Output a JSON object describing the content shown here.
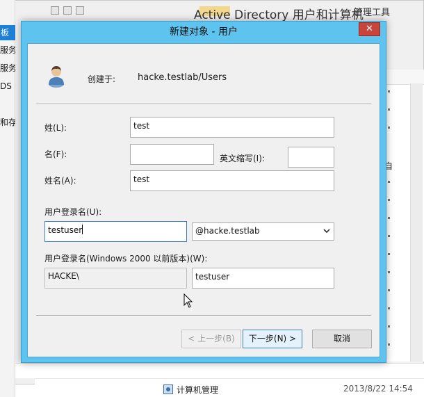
{
  "background": {
    "window_title": "Active Directory 用户和计算机",
    "menu_label": "管理工具",
    "left_items": [
      "板",
      "服务",
      "服务",
      "DS",
      "和存"
    ],
    "right_text": "自",
    "taskbar_item": "计算机管理",
    "timestamp": "2013/8/22 14:54"
  },
  "dialog": {
    "title": "新建对象 - 用户",
    "close_glyph": "✕",
    "created_in_label": "创建于:",
    "created_in_value": "hacke.testlab/Users",
    "last_name_label": "姓(L):",
    "last_name_value": "test",
    "first_name_label": "名(F):",
    "first_name_value": "",
    "initials_label": "英文缩写(I):",
    "initials_value": "",
    "full_name_label": "姓名(A):",
    "full_name_value": "test",
    "logon_name_label": "用户登录名(U):",
    "logon_name_value": "testuser",
    "domain_selected": "@hacke.testlab",
    "pre2000_label": "用户登录名(Windows 2000 以前版本)(W):",
    "pre2000_domain": "HACKE\\",
    "pre2000_name": "testuser",
    "back_button": "< 上一步(B)",
    "next_button": "下一步(N) >",
    "cancel_button": "取消"
  },
  "colors": {
    "dialog_frame": "#5ec3ee",
    "close_button": "#c7453a",
    "selection_blue": "#1e7fd6"
  },
  "icons": {
    "user": "user-icon",
    "close": "close-icon",
    "dropdown": "chevron-down-icon",
    "cursor": "mouse-cursor-icon",
    "management": "computer-management-icon"
  }
}
